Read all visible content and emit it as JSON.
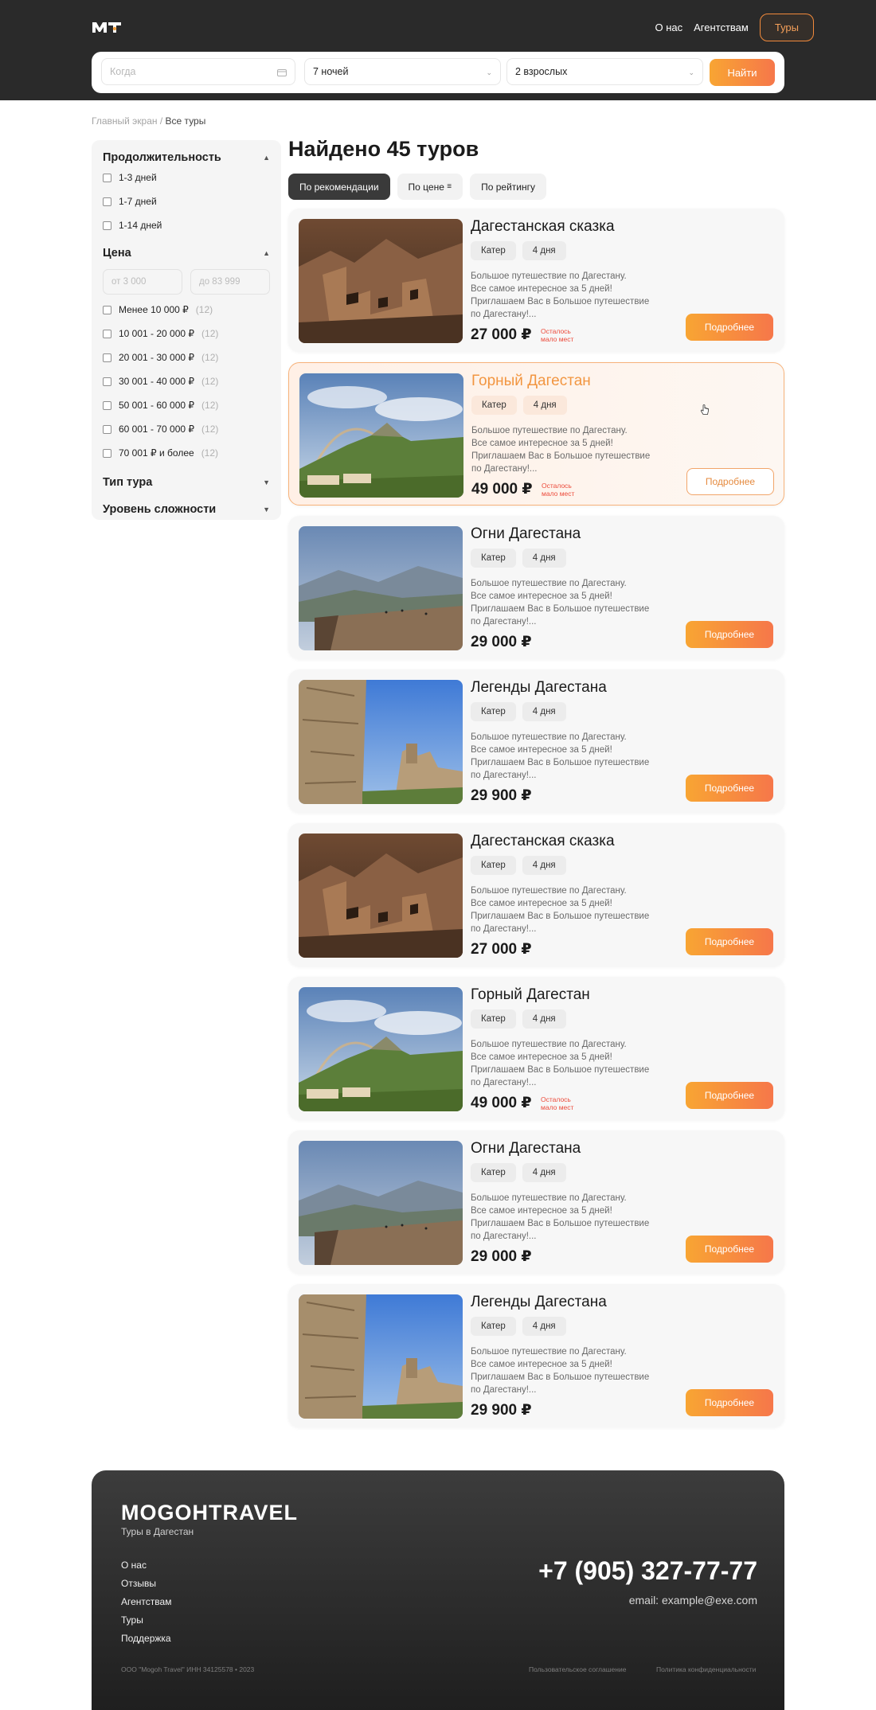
{
  "header": {
    "nav": [
      "О нас",
      "Агентствам"
    ],
    "tours_button": "Туры"
  },
  "search": {
    "when_placeholder": "Когда",
    "nights": "7 ночей",
    "adults": "2 взрослых",
    "find_button": "Найти"
  },
  "breadcrumb": {
    "home": "Главный экран",
    "separator": "/",
    "current": "Все туры"
  },
  "filters": {
    "duration": {
      "title": "Продолжительность",
      "options": [
        "1-3 дней",
        "1-7 дней",
        "1-14 дней"
      ]
    },
    "price": {
      "title": "Цена",
      "from_placeholder": "от 3 000",
      "to_placeholder": "до 83 999",
      "options": [
        {
          "label": "Менее 10 000 ₽",
          "count": "(12)"
        },
        {
          "label": "10 001 - 20 000 ₽",
          "count": "(12)"
        },
        {
          "label": "20 001 - 30 000 ₽",
          "count": "(12)"
        },
        {
          "label": "30 001 - 40 000 ₽",
          "count": "(12)"
        },
        {
          "label": "50 001 - 60 000 ₽",
          "count": "(12)"
        },
        {
          "label": "60 001 - 70 000 ₽",
          "count": "(12)"
        },
        {
          "label": "70 001 ₽ и более",
          "count": "(12)"
        }
      ]
    },
    "tour_type": {
      "title": "Тип тура"
    },
    "difficulty": {
      "title": "Уровень сложности"
    }
  },
  "results": {
    "title": "Найдено 45 туров",
    "sort": [
      "По рекомендации",
      "По цене",
      "По рейтингу"
    ]
  },
  "tours": [
    {
      "title": "Дагестанская сказка",
      "tags": [
        "Катер",
        "4 дня"
      ],
      "desc": [
        "Большое путешествие по Дагестану.",
        "Все самое интересное за 5 дней!",
        "Приглашаем Вас в Большое путешествие",
        "по Дагестану!..."
      ],
      "price": "27 000 ₽",
      "seats": [
        "Осталось",
        "мало мест"
      ],
      "button": "Подробнее",
      "image": "ruins"
    },
    {
      "title": "Горный Дагестан",
      "tags": [
        "Катер",
        "4 дня"
      ],
      "desc": [
        "Большое путешествие по Дагестану.",
        "Все самое интересное за 5 дней!",
        "Приглашаем Вас в Большое путешествие",
        "по Дагестану!..."
      ],
      "price": "49 000 ₽",
      "seats": [
        "Осталось",
        "мало мест"
      ],
      "button": "Подробнее",
      "image": "rainbow"
    },
    {
      "title": "Огни Дагестана",
      "tags": [
        "Катер",
        "4 дня"
      ],
      "desc": [
        "Большое путешествие по Дагестану.",
        "Все самое интересное за 5 дней!",
        "Приглашаем Вас в Большое путешествие",
        "по Дагестану!..."
      ],
      "price": "29 000 ₽",
      "seats": [
        "",
        ""
      ],
      "button": "Подробнее",
      "image": "cliff"
    },
    {
      "title": "Легенды Дагестана",
      "tags": [
        "Катер",
        "4 дня"
      ],
      "desc": [
        "Большое путешествие по Дагестану.",
        "Все самое интересное за 5 дней!",
        "Приглашаем Вас в Большое путешествие",
        "по Дагестану!..."
      ],
      "price": "29 900 ₽",
      "seats": [
        "",
        ""
      ],
      "button": "Подробнее",
      "image": "fortress"
    },
    {
      "title": "Дагестанская сказка",
      "tags": [
        "Катер",
        "4 дня"
      ],
      "desc": [
        "Большое путешествие по Дагестану.",
        "Все самое интересное за 5 дней!",
        "Приглашаем Вас в Большое путешествие",
        "по Дагестану!..."
      ],
      "price": "27 000 ₽",
      "seats": [
        "",
        ""
      ],
      "button": "Подробнее",
      "image": "ruins"
    },
    {
      "title": "Горный Дагестан",
      "tags": [
        "Катер",
        "4 дня"
      ],
      "desc": [
        "Большое путешествие по Дагестану.",
        "Все самое интересное за 5 дней!",
        "Приглашаем Вас в Большое путешествие",
        "по Дагестану!..."
      ],
      "price": "49 000 ₽",
      "seats": [
        "Осталось",
        "мало мест"
      ],
      "button": "Подробнее",
      "image": "rainbow"
    },
    {
      "title": "Огни Дагестана",
      "tags": [
        "Катер",
        "4 дня"
      ],
      "desc": [
        "Большое путешествие по Дагестану.",
        "Все самое интересное за 5 дней!",
        "Приглашаем Вас в Большое путешествие",
        "по Дагестану!..."
      ],
      "price": "29 000 ₽",
      "seats": [
        "",
        ""
      ],
      "button": "Подробнее",
      "image": "cliff"
    },
    {
      "title": "Легенды Дагестана",
      "tags": [
        "Катер",
        "4 дня"
      ],
      "desc": [
        "Большое путешествие по Дагестану.",
        "Все самое интересное за 5 дней!",
        "Приглашаем Вас в Большое путешествие",
        "по Дагестану!..."
      ],
      "price": "29 900 ₽",
      "seats": [
        "",
        ""
      ],
      "button": "Подробнее",
      "image": "fortress"
    }
  ],
  "footer": {
    "logo": "MOGOHTRAVEL",
    "subtitle": "Туры в Дагестан",
    "links": [
      "О нас",
      "Отзывы",
      "Агентствам",
      "Туры",
      "Поддержка"
    ],
    "phone": "+7 (905) 327-77-77",
    "email": "email: example@exe.com",
    "copyright": "ООО \"Mogoh Travel\" ИНН 34125578 • 2023",
    "terms": "Пользовательское соглашение",
    "privacy": "Политика конфиденциальности"
  },
  "colors": {
    "accent": "#f6894a",
    "header_bg": "#2a2a2a",
    "alert": "#ec4a3a"
  }
}
